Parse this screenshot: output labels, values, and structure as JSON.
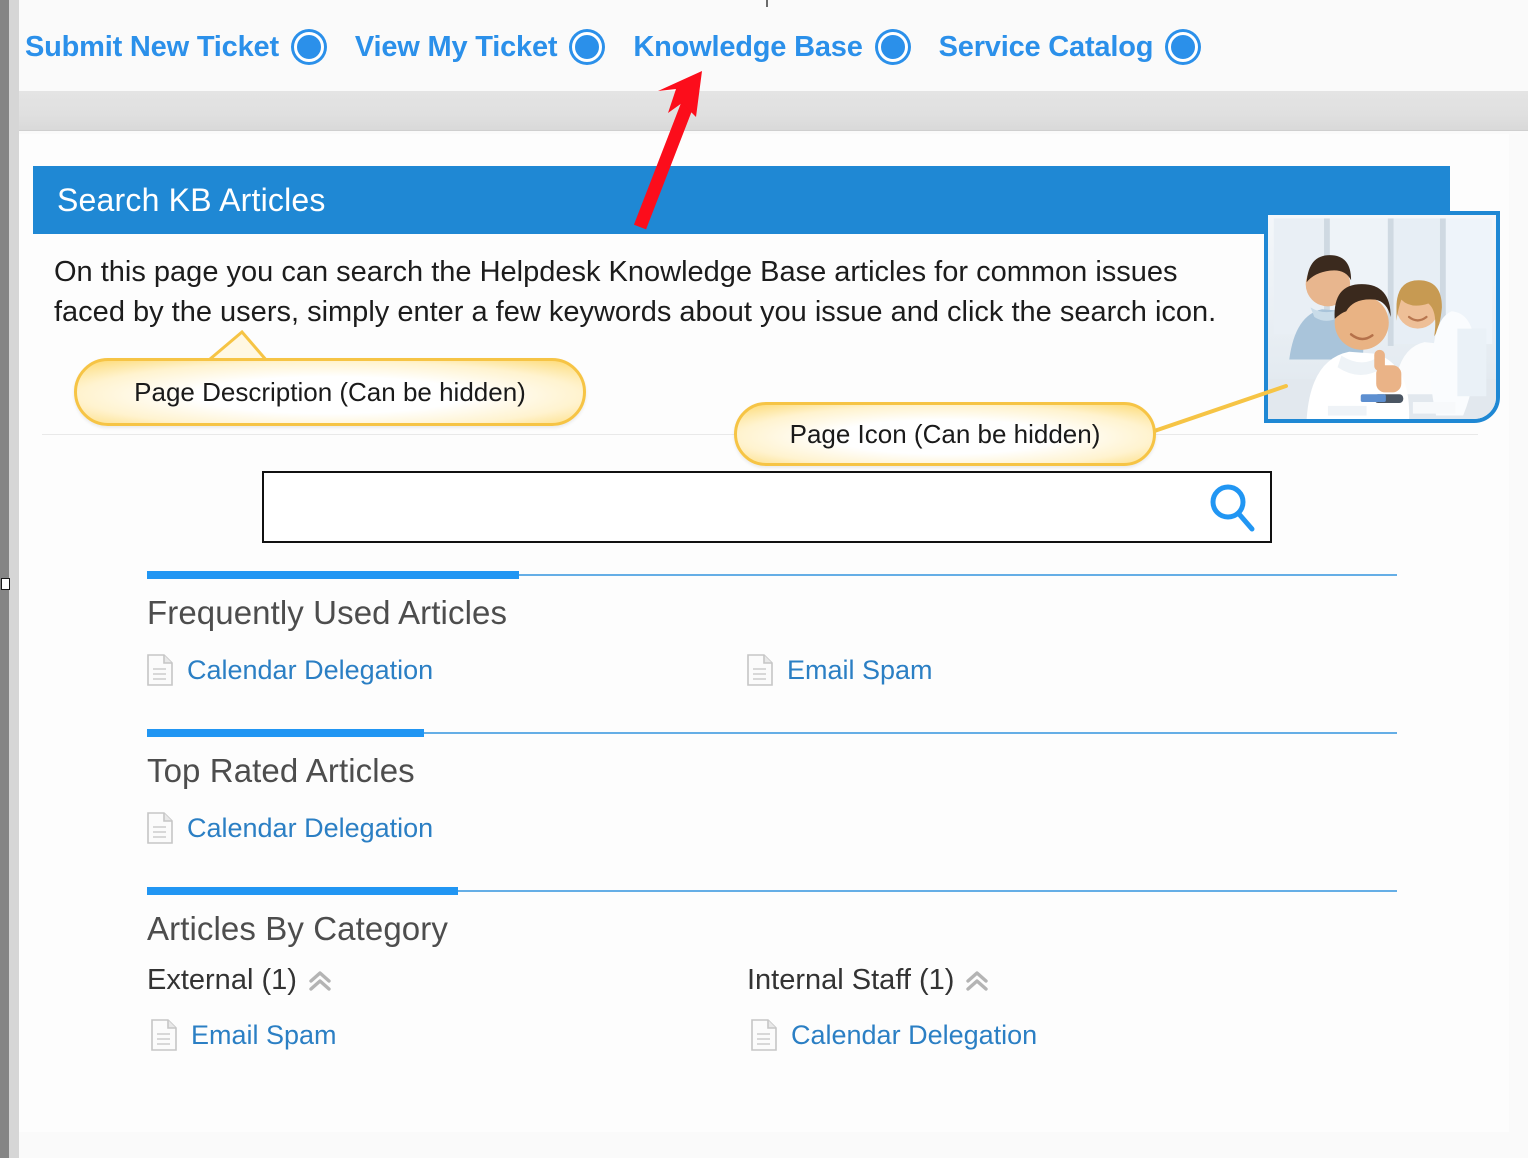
{
  "topnav": {
    "items": [
      {
        "label": "Submit New Ticket",
        "icon": "circle-arrow-right-icon"
      },
      {
        "label": "View My Ticket",
        "icon": "circle-arrow-right-icon"
      },
      {
        "label": "Knowledge Base",
        "icon": "circle-arrow-right-icon"
      },
      {
        "label": "Service Catalog",
        "icon": "circle-arrow-right-icon"
      }
    ]
  },
  "page": {
    "title": "Search KB Articles",
    "description": "On this page you can search the Helpdesk Knowledge Base articles for common issues faced by the users, simply enter a few keywords about you issue and click the search icon."
  },
  "search": {
    "value": "",
    "placeholder": "",
    "button_icon": "search-icon"
  },
  "photo": {
    "alt": "Page icon photo of three coworkers at a computer, one giving a thumbs up"
  },
  "annotations": [
    {
      "id": "page-description",
      "text": "Page Description (Can be hidden)"
    },
    {
      "id": "page-icon",
      "text": "Page Icon (Can be hidden)"
    },
    {
      "id": "pointer-arrow",
      "text": "",
      "color": "#fc0d1b",
      "points_to": "Knowledge Base"
    }
  ],
  "sections": [
    {
      "id": "frequently-used",
      "title": "Frequently Used Articles",
      "articles": [
        {
          "name": "Calendar Delegation",
          "icon": "document-icon"
        },
        {
          "name": "Email Spam",
          "icon": "document-icon"
        }
      ]
    },
    {
      "id": "top-rated",
      "title": "Top Rated Articles",
      "articles": [
        {
          "name": "Calendar Delegation",
          "icon": "document-icon"
        }
      ]
    },
    {
      "id": "by-category",
      "title": "Articles By Category",
      "categories": [
        {
          "label": "External (1)",
          "toggle_icon": "chevron-double-up-icon",
          "articles": [
            {
              "name": "Email Spam",
              "icon": "document-icon"
            }
          ]
        },
        {
          "label": "Internal Staff (1)",
          "toggle_icon": "chevron-double-up-icon",
          "articles": [
            {
              "name": "Calendar Delegation",
              "icon": "document-icon"
            }
          ]
        }
      ]
    }
  ],
  "colors": {
    "nav_link": "#2b90ea",
    "title_bar": "#1f88d4",
    "accent_blue": "#2196f3",
    "rule_blue": "#65aee6",
    "link_blue": "#2b7fc4",
    "callout_border": "#f6c445",
    "arrow_red": "#fc0d1b",
    "gray_band": "#e0e0e0"
  }
}
